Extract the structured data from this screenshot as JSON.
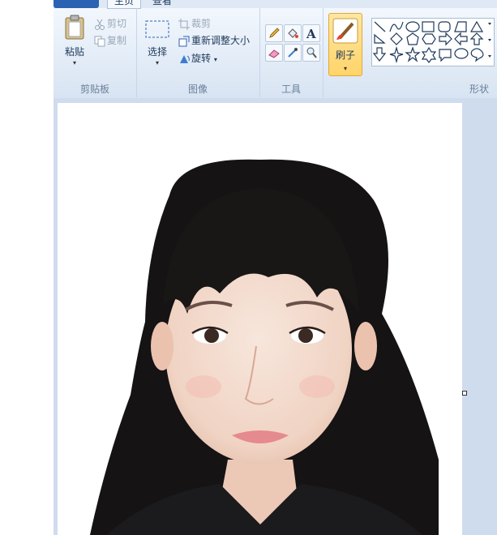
{
  "tabs": [
    {
      "label": "",
      "kind": "file"
    },
    {
      "label": "主页"
    },
    {
      "label": "查看"
    }
  ],
  "groups": {
    "clipboard": {
      "label": "剪贴板",
      "paste": "粘贴",
      "cut": "剪切",
      "copy": "复制"
    },
    "image": {
      "label": "图像",
      "select": "选择",
      "crop": "裁剪",
      "resize": "重新调整大小",
      "rotate": "旋转"
    },
    "tools": {
      "label": "工具",
      "items": [
        "pencil-icon",
        "fill-icon",
        "text-icon",
        "eraser-icon",
        "color-picker-icon",
        "magnifier-icon"
      ]
    },
    "brushes": {
      "label": "刷子"
    },
    "shapes": {
      "label": "形状"
    }
  },
  "colors": {
    "ribbon_bg": "#e3ecf7",
    "canvas_area_bg": "#cfdcee",
    "file_tab": "#2b62b3",
    "brush_highlight": "#ffd46a"
  },
  "canvas": {
    "content": "portrait photo of a young woman with long black hair and bangs on a white background"
  }
}
